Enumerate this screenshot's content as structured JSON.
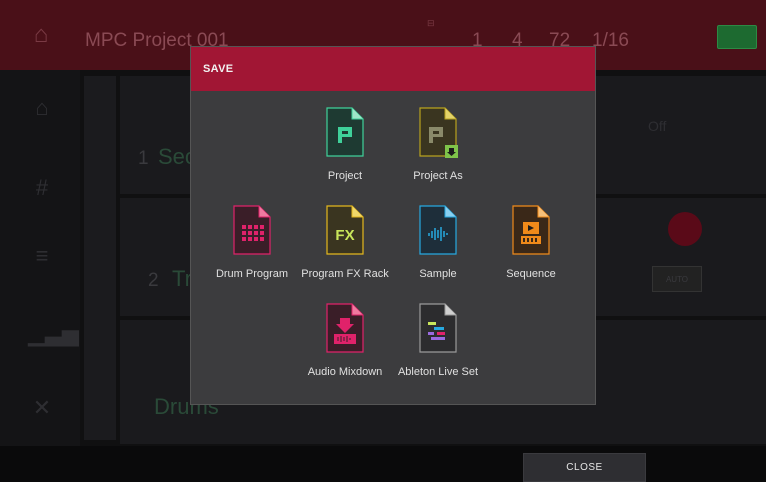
{
  "header": {
    "project_name": "MPC Project 001",
    "values": [
      "1",
      "4",
      "72",
      "1/16"
    ]
  },
  "background": {
    "seq_number": "1",
    "seq_name_partial": "Sec",
    "track_number": "2",
    "track_name_partial": "Tr",
    "program_name_partial": "Drums",
    "timecode_label": "Off",
    "auto_label": "AUTO"
  },
  "dialog": {
    "title": "SAVE",
    "items": [
      {
        "label": "Project",
        "icon": "project-icon",
        "color": "#3fd19a"
      },
      {
        "label": "Project As",
        "icon": "project-as-icon",
        "color": "#b8a21e"
      },
      {
        "label": "Drum Program",
        "icon": "drum-program-icon",
        "color": "#e0226a"
      },
      {
        "label": "Program FX Rack",
        "icon": "program-fx-rack-icon",
        "color": "#e3b71e"
      },
      {
        "label": "Sample",
        "icon": "sample-icon",
        "color": "#27a9e0"
      },
      {
        "label": "Sequence",
        "icon": "sequence-icon",
        "color": "#f08a1a"
      },
      {
        "label": "Audio Mixdown",
        "icon": "audio-mixdown-icon",
        "color": "#e0226a"
      },
      {
        "label": "Ableton Live Set",
        "icon": "ableton-live-set-icon",
        "color": "#9a9a9a"
      }
    ]
  },
  "footer": {
    "close_label": "CLOSE"
  }
}
